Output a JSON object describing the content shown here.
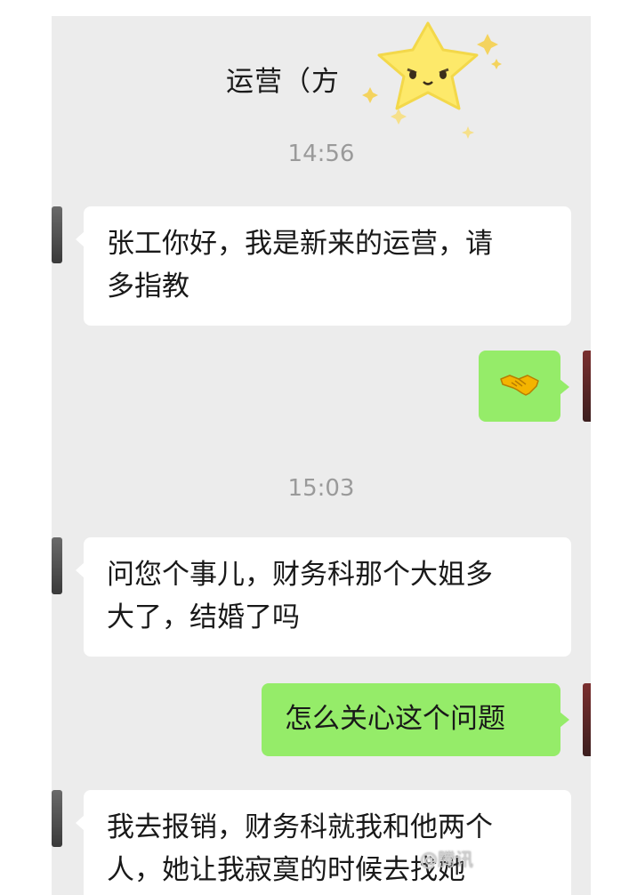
{
  "header": {
    "title": "运营（方"
  },
  "messages": [
    {
      "time": "14:56"
    },
    {
      "side": "in",
      "text": "张工你好，我是新来的运营，请\n多指教"
    },
    {
      "side": "out",
      "icon": "handshake-emoji"
    },
    {
      "time": "15:03"
    },
    {
      "side": "in",
      "text": "问您个事儿，财务科那个大姐多\n大了，结婚了吗"
    },
    {
      "side": "out",
      "text": "怎么关心这个问题"
    },
    {
      "side": "in",
      "text": "我去报销，财务科就我和他两个\n人，她让我寂寞的时候去找她"
    }
  ],
  "watermark": "@腾讯"
}
